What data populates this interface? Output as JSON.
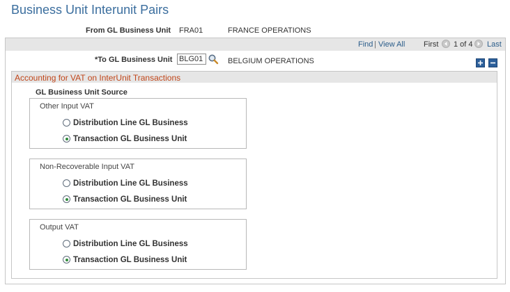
{
  "page": {
    "title": "Business Unit Interunit Pairs"
  },
  "from_bu": {
    "label": "From GL Business Unit",
    "code": "FRA01",
    "name": "FRANCE OPERATIONS"
  },
  "nav": {
    "find": "Find",
    "separator": "|",
    "view_all": "View All",
    "first": "First",
    "position": "1 of 4",
    "last": "Last"
  },
  "to_bu": {
    "label": "*To GL Business Unit",
    "value": "BLG01",
    "name": "BELGIUM OPERATIONS",
    "lookup_icon": "magnifier-icon"
  },
  "row_controls": {
    "add": "+",
    "remove": "−"
  },
  "section": {
    "title": "Accounting for VAT on InterUnit Transactions",
    "source_label": "GL Business Unit Source",
    "groups": [
      {
        "title": "Other Input VAT",
        "options": [
          {
            "label": "Distribution Line GL Business",
            "checked": false
          },
          {
            "label": "Transaction GL Business Unit",
            "checked": true
          }
        ]
      },
      {
        "title": "Non-Recoverable Input VAT",
        "options": [
          {
            "label": "Distribution Line GL Business",
            "checked": false
          },
          {
            "label": "Transaction GL Business Unit",
            "checked": true
          }
        ]
      },
      {
        "title": "Output VAT",
        "options": [
          {
            "label": "Distribution Line GL Business",
            "checked": false
          },
          {
            "label": "Transaction GL Business Unit",
            "checked": true
          }
        ]
      }
    ]
  },
  "colors": {
    "title_blue": "#3b6e9e",
    "link_blue": "#2a5c8a",
    "section_orange": "#c0461a",
    "radio_green": "#2e8b3a"
  }
}
